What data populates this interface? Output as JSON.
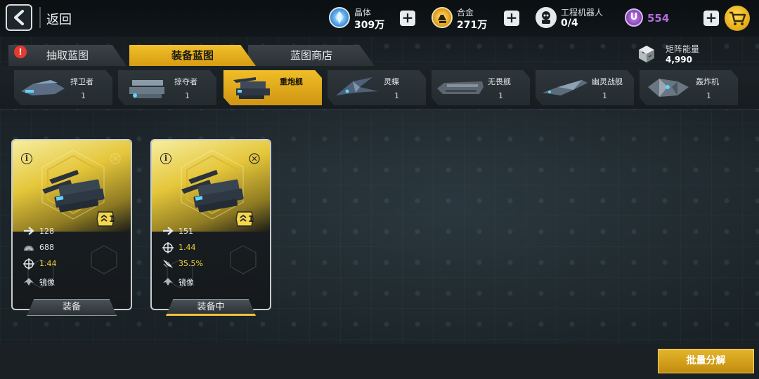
{
  "topbar": {
    "back_label": "返回",
    "resources": [
      {
        "label": "晶体",
        "value": "309万",
        "icon": "crystal-icon"
      },
      {
        "label": "合金",
        "value": "271万",
        "icon": "alloy-icon"
      },
      {
        "label": "工程机器人",
        "value": "0/4",
        "icon": "robot-icon"
      }
    ],
    "u_currency": {
      "symbol": "U",
      "value": "554"
    }
  },
  "tabs": [
    {
      "label": "抽取蓝图",
      "active": false,
      "badge": "!"
    },
    {
      "label": "装备蓝图",
      "active": true
    },
    {
      "label": "蓝图商店",
      "active": false
    }
  ],
  "matrix_energy": {
    "label": "矩阵能量",
    "value": "4,990"
  },
  "ships": [
    {
      "name": "捍卫者",
      "count": "1",
      "active": false
    },
    {
      "name": "掠夺者",
      "count": "1",
      "active": false
    },
    {
      "name": "重炮舰",
      "count": "1",
      "active": true
    },
    {
      "name": "灵蝶",
      "count": "1",
      "active": false
    },
    {
      "name": "无畏舰",
      "count": "1",
      "active": false
    },
    {
      "name": "幽灵战舰",
      "count": "1",
      "active": false
    },
    {
      "name": "轰炸机",
      "count": "1",
      "active": false
    }
  ],
  "cards": [
    {
      "level": "1",
      "stats": [
        {
          "icon": "speed-arrow-icon",
          "value": "128"
        },
        {
          "icon": "radar-icon",
          "value": "688"
        },
        {
          "icon": "crosshair-icon",
          "value": "1.44",
          "highlight": true
        },
        {
          "icon": "mirror-icon",
          "value": "镜像"
        }
      ],
      "button": "装备",
      "equipped": false
    },
    {
      "level": "1",
      "stats": [
        {
          "icon": "speed-arrow-icon",
          "value": "151"
        },
        {
          "icon": "crosshair-icon",
          "value": "1.44",
          "highlight": true
        },
        {
          "icon": "rocket-icon",
          "value": "35.5%",
          "highlight": true
        },
        {
          "icon": "mirror-icon",
          "value": "镜像"
        }
      ],
      "button": "装备中",
      "equipped": true
    }
  ],
  "bottom": {
    "batch_button": "批量分解"
  },
  "colors": {
    "accent": "#f0be28",
    "u_purple": "#b16ddb",
    "alert": "#e53a2f"
  }
}
